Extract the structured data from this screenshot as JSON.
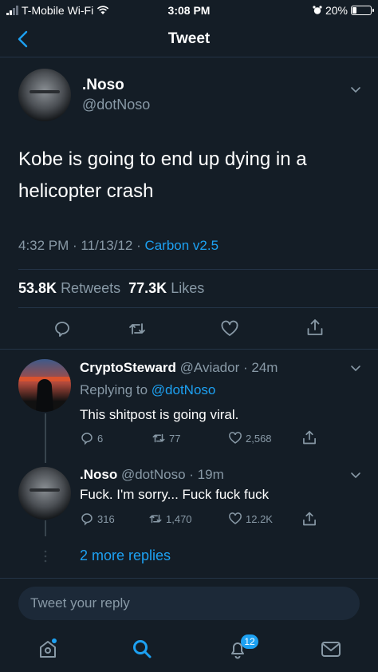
{
  "status_bar": {
    "carrier": "T-Mobile Wi-Fi",
    "time": "3:08 PM",
    "battery": "20%",
    "battery_level": 0.2
  },
  "nav": {
    "title": "Tweet",
    "back_icon": "chevron-left-icon"
  },
  "tweet": {
    "name": ".Noso",
    "handle": "@dotNoso",
    "text": "Kobe is going to end up dying in a helicopter crash",
    "time": "4:32 PM",
    "date": "11/13/12",
    "source": "Carbon v2.5",
    "retweets_count": "53.8K",
    "retweets_label": "Retweets",
    "likes_count": "77.3K",
    "likes_label": "Likes"
  },
  "replies": [
    {
      "name": "CryptoSteward",
      "handle": "@Aviador",
      "time": "24m",
      "replying_prefix": "Replying to",
      "replying_to": "@dotNoso",
      "text": "This shitpost is going viral.",
      "reply_count": "6",
      "retweet_count": "77",
      "like_count": "2,568"
    },
    {
      "name": ".Noso",
      "handle": "@dotNoso",
      "time": "19m",
      "text": "Fuck. I'm sorry... Fuck fuck fuck",
      "reply_count": "316",
      "retweet_count": "1,470",
      "like_count": "12.2K"
    }
  ],
  "more_replies": "2 more replies",
  "compose": {
    "placeholder": "Tweet your reply"
  },
  "tab_bar": {
    "notifications_badge": "12"
  },
  "colors": {
    "background": "#141d26",
    "accent": "#1da1f2",
    "muted": "#8899a6",
    "divider": "#243447"
  }
}
